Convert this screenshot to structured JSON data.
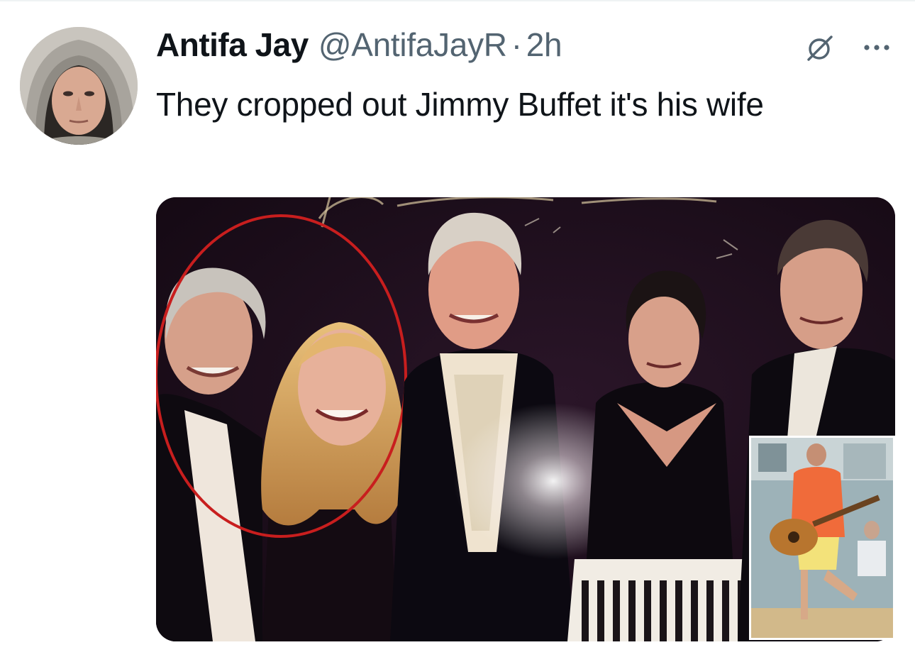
{
  "tweet": {
    "display_name": "Antifa Jay",
    "handle": "@AntifaJayR",
    "separator": "·",
    "timestamp": "2h",
    "text": "They cropped out Jimmy Buffet it's his wife"
  },
  "icons": {
    "avatar": "user-avatar",
    "grok": "grok-icon",
    "more": "more-options-icon"
  },
  "colors": {
    "text_primary": "#0f1419",
    "text_secondary": "#536471",
    "highlight_circle": "#c81e1e"
  }
}
